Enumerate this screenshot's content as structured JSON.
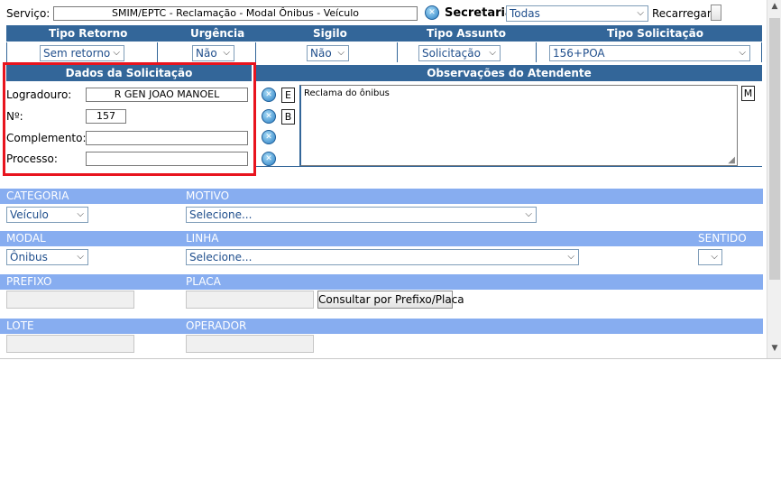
{
  "top": {
    "servico_label": "Serviço:",
    "servico_value": "SMIM/EPTC - Reclamação - Modal Ônibus - Veículo",
    "secretaria_label": "Secretaria:",
    "secretaria_value": "Todas",
    "recarregar_label": "Recarregar:"
  },
  "header_row": {
    "tipo_retorno": "Tipo Retorno",
    "urgencia": "Urgência",
    "sigilo": "Sigilo",
    "tipo_assunto": "Tipo Assunto",
    "tipo_solicitacao": "Tipo Solicitação"
  },
  "selects_row": {
    "tipo_retorno": "Sem retorno",
    "urgencia": "Não",
    "sigilo": "Não",
    "tipo_assunto": "Solicitação",
    "tipo_solicitacao": "156+POA"
  },
  "dados": {
    "title": "Dados da Solicitação",
    "logradouro_label": "Logradouro:",
    "logradouro_value": "R GEN JOAO MANOEL",
    "numero_label": "Nº:",
    "numero_value": "157",
    "complemento_label": "Complemento:",
    "complemento_value": "",
    "processo_label": "Processo:",
    "processo_value": "",
    "btn_e": "E",
    "btn_b": "B"
  },
  "observacoes": {
    "title": "Observações do Atendente",
    "text": "Reclama do ônibus",
    "btn_m": "M"
  },
  "form": {
    "categoria_label": "CATEGORIA",
    "categoria_value": "Veículo",
    "motivo_label": "MOTIVO",
    "motivo_value": "Selecione...",
    "modal_label": "MODAL",
    "modal_value": "Ônibus",
    "linha_label": "LINHA",
    "linha_value": "Selecione...",
    "sentido_label": "SENTIDO",
    "sentido_value": "",
    "prefixo_label": "PREFIXO",
    "placa_label": "PLACA",
    "consultar_label": "Consultar por Prefixo/Placa",
    "lote_label": "LOTE",
    "operador_label": "OPERADOR"
  },
  "colors": {
    "header_blue": "#336699",
    "band_blue": "#87adf0",
    "highlight_red": "#e8141e"
  }
}
